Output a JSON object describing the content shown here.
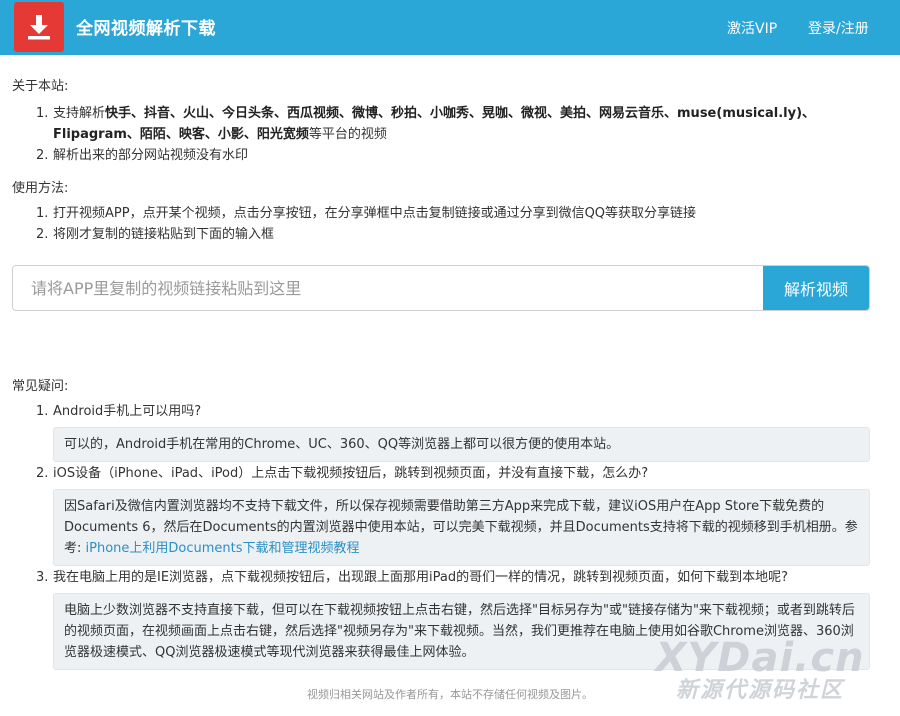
{
  "header": {
    "title": "全网视频解析下载",
    "nav": {
      "vip": "激活VIP",
      "login": "登录/注册"
    },
    "logo_icon": "download-icon",
    "colors": {
      "bar": "#2aa6d7",
      "logo": "#e53935"
    }
  },
  "about": {
    "title": "关于本站:",
    "item1": {
      "num": "1.",
      "prefix": "支持解析",
      "platforms": "快手、抖音、火山、今日头条、西瓜视频、微博、秒拍、小咖秀、晃咖、微视、美拍、网易云音乐、muse(musical.ly)、Flipagram、陌陌、映客、小影、阳光宽频",
      "suffix": "等平台的视频"
    },
    "item2": {
      "num": "2.",
      "text": "解析出来的部分网站视频没有水印"
    }
  },
  "usage": {
    "title": "使用方法:",
    "items": [
      {
        "num": "1.",
        "text": "打开视频APP，点开某个视频，点击分享按钮，在分享弹框中点击复制链接或通过分享到微信QQ等获取分享链接"
      },
      {
        "num": "2.",
        "text": "将刚才复制的链接粘贴到下面的输入框"
      }
    ]
  },
  "search": {
    "placeholder": "请将APP里复制的视频链接粘贴到这里",
    "value": "",
    "button": "解析视频"
  },
  "faq": {
    "title": "常见疑问:",
    "items": [
      {
        "num": "1.",
        "question": "Android手机上可以用吗?",
        "answer": "可以的，Android手机在常用的Chrome、UC、360、QQ等浏览器上都可以很方便的使用本站。"
      },
      {
        "num": "2.",
        "question": "iOS设备（iPhone、iPad、iPod）上点击下载视频按钮后，跳转到视频页面，并没有直接下载，怎么办?",
        "answer": "因Safari及微信内置浏览器均不支持下载文件，所以保存视频需要借助第三方App来完成下载，建议iOS用户在App Store下载免费的Documents 6，然后在Documents的内置浏览器中使用本站，可以完美下载视频，并且Documents支持将下载的视频移到手机相册。参考:",
        "link": "iPhone上利用Documents下载和管理视频教程"
      },
      {
        "num": "3.",
        "question": "我在电脑上用的是IE浏览器，点下载视频按钮后，出现跟上面那用iPad的哥们一样的情况，跳转到视频页面，如何下载到本地呢?",
        "answer": "电脑上少数浏览器不支持直接下载，但可以在下载视频按钮上点击右键，然后选择\"目标另存为\"或\"链接存储为\"来下载视频；或者到跳转后的视频页面，在视频画面上点击右键，然后选择\"视频另存为\"来下载视频。当然，我们更推荐在电脑上使用如谷歌Chrome浏览器、360浏览器极速模式、QQ浏览器极速模式等现代浏览器来获得最佳上网体验。"
      }
    ]
  },
  "footer": {
    "text": "视频归相关网站及作者所有，本站不存储任何视频及图片。"
  },
  "watermark": {
    "main": "XYDai.cn",
    "sub": "新源代源码社区"
  }
}
